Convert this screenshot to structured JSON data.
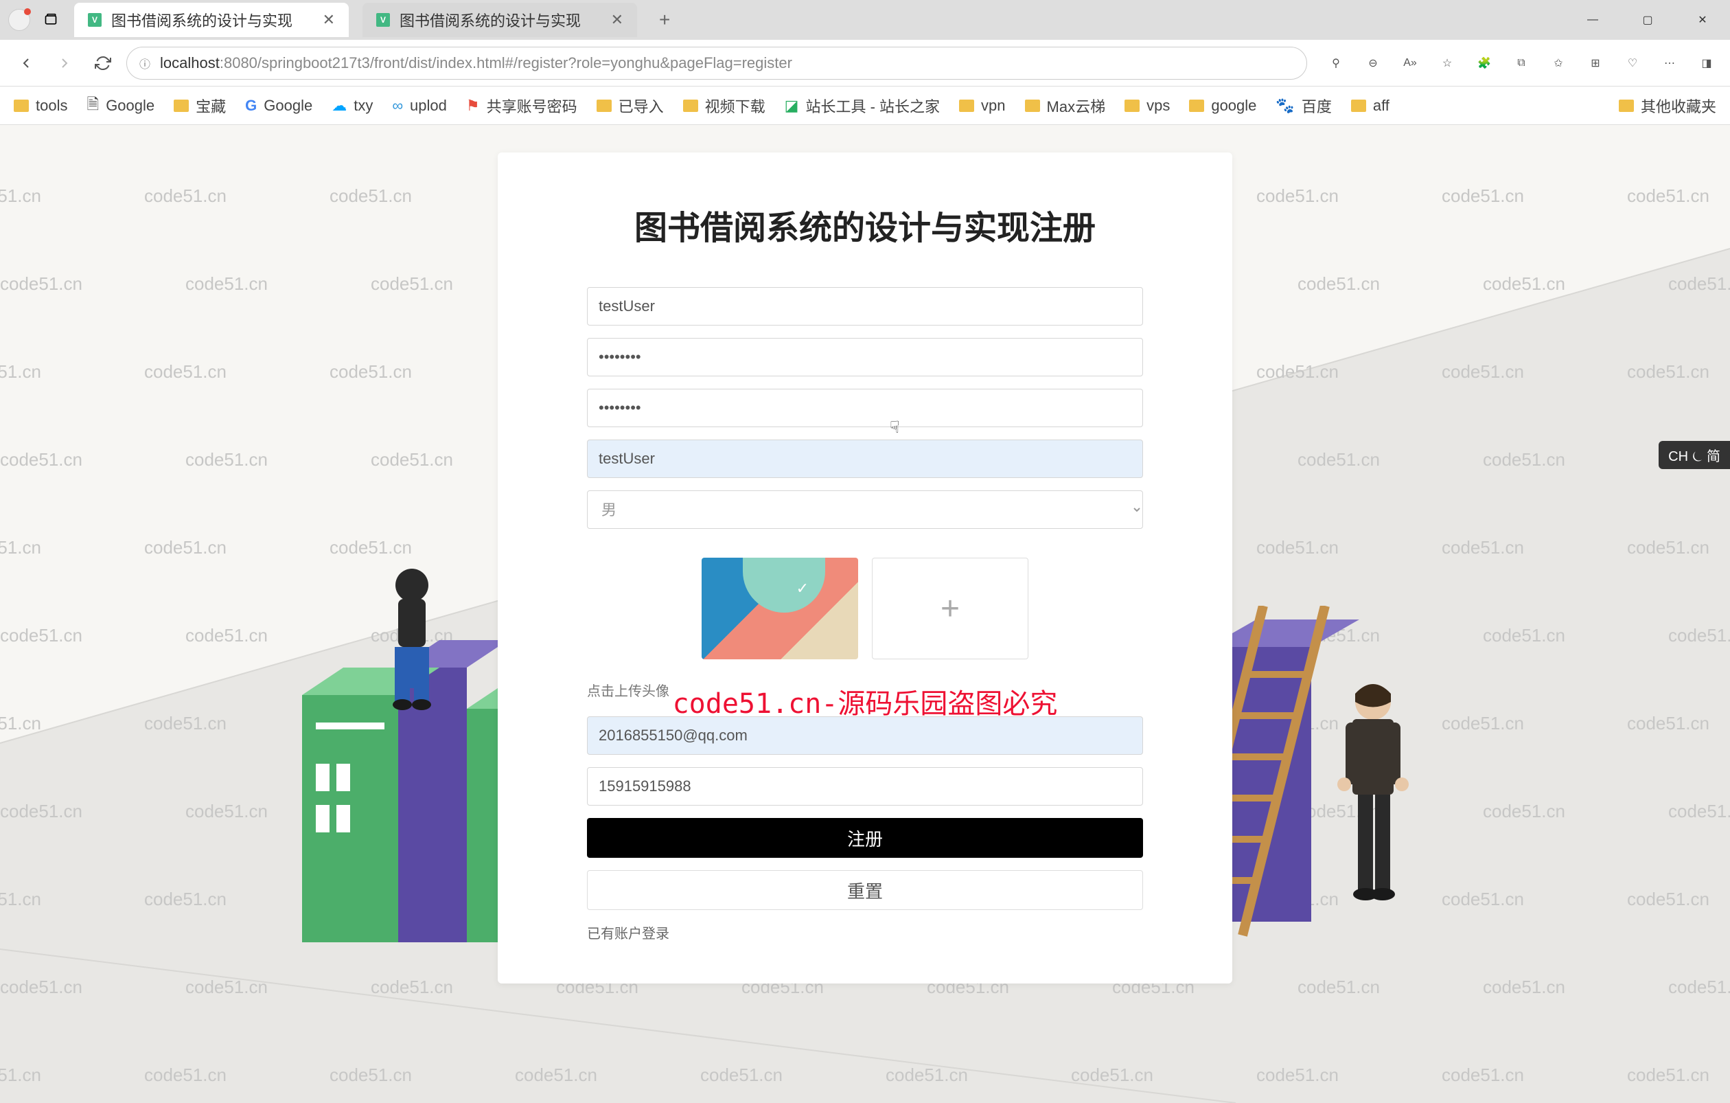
{
  "browser": {
    "tabs": [
      {
        "title": "图书借阅系统的设计与实现",
        "active": true
      },
      {
        "title": "图书借阅系统的设计与实现",
        "active": false
      }
    ],
    "url_host": "localhost",
    "url_path": ":8080/springboot217t3/front/dist/index.html#/register?role=yonghu&pageFlag=register",
    "bookmarks": [
      "tools",
      "Google",
      "宝藏",
      "Google",
      "txy",
      "uplod",
      "共享账号密码",
      "已导入",
      "视频下载",
      "站长工具 - 站长之家",
      "vpn",
      "Max云梯",
      "vps",
      "google",
      "百度",
      "aff"
    ],
    "bookmarks_other": "其他收藏夹"
  },
  "page": {
    "title": "图书借阅系统的设计与实现注册",
    "inputs": {
      "username": "testUser",
      "password": "••••••••",
      "confirm_password": "••••••••",
      "nickname": "testUser",
      "gender_placeholder": "男",
      "email": "2016855150@qq.com",
      "phone": "15915915988"
    },
    "upload_hint": "点击上传头像",
    "btn_register": "注册",
    "btn_reset": "重置",
    "login_link": "已有账户登录",
    "watermark_text": "code51.cn",
    "watermark_red": "code51.cn-源码乐园盗图必究",
    "ime": "CH ⏾ 简"
  }
}
